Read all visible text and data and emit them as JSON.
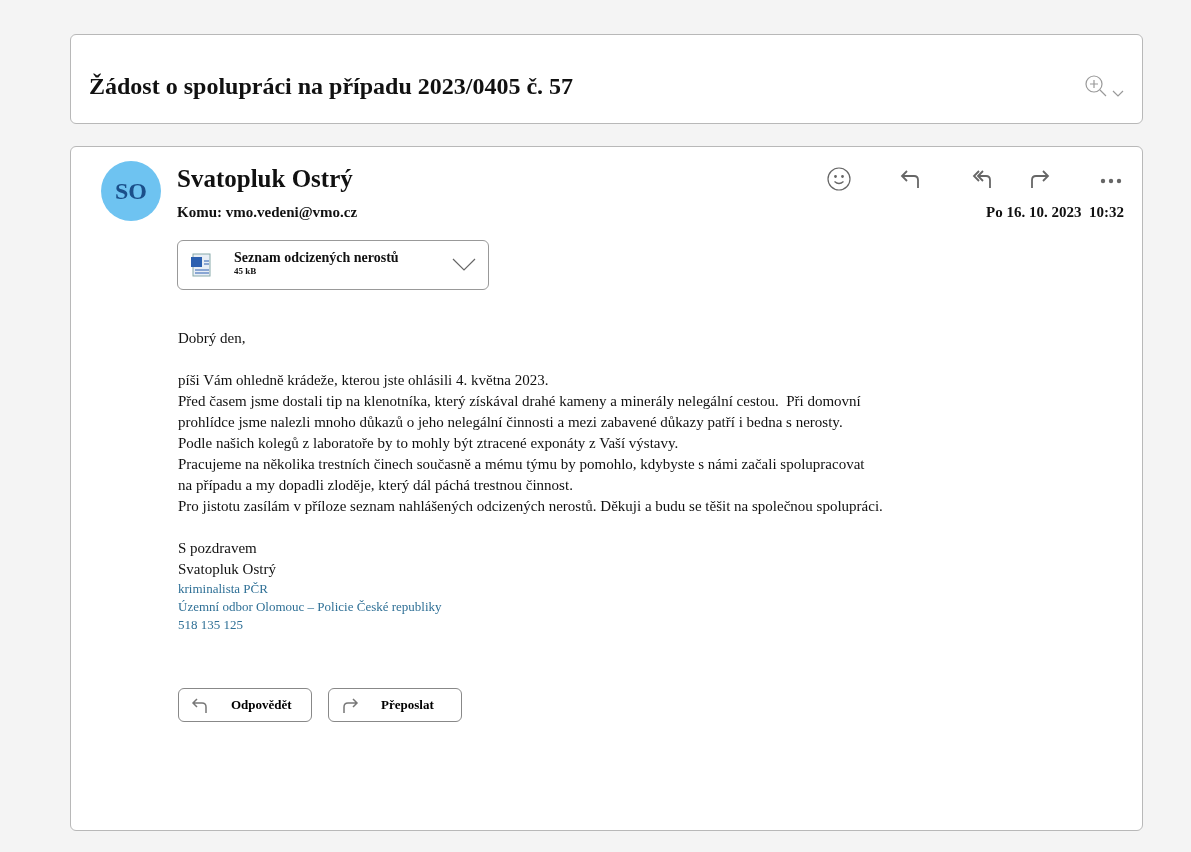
{
  "subject": "Žádost o spolupráci na případu 2023/0405 č. 57",
  "message": {
    "avatar_initials": "SO",
    "sender": "Svatopluk Ostrý",
    "to": "Komu: vmo.vedeni@vmo.cz",
    "date": "Po 16. 10. 2023  10:32",
    "attachment": {
      "name": "Seznam odcizených nerostů",
      "size": "45 kB"
    },
    "greeting": "Dobrý den,",
    "body_lines": [
      "píši Vám ohledně krádeže, kterou jste ohlásili 4. května 2023.",
      "Před časem jsme dostali tip na klenotníka, který získával drahé kameny a minerály nelegální cestou.  Při domovní",
      "prohlídce jsme nalezli mnoho důkazů o jeho nelegální činnosti a mezi zabavené důkazy patří i bedna s nerosty.",
      "Podle našich kolegů z laboratoře by to mohly být ztracené exponáty z Vaší výstavy.",
      "Pracujeme na několika trestních činech současně a mému týmu by pomohlo, kdybyste s námi začali spolupracovat",
      "na případu a my dopadli zloděje, který dál páchá trestnou činnost.",
      "Pro jistotu zasílám v příloze seznam nahlášených odcizených nerostů. Děkuji a budu se těšit na společnou spolupráci."
    ],
    "signature": [
      {
        "text": "S pozdravem",
        "kind": "plain"
      },
      {
        "text": "Svatopluk Ostrý",
        "kind": "plain"
      },
      {
        "text": "kriminalista PČR",
        "kind": "accent"
      },
      {
        "text": "Územní odbor Olomouc – Policie České republiky",
        "kind": "accent"
      },
      {
        "text": "518 135 125",
        "kind": "accent"
      }
    ],
    "actions": [
      {
        "label": "Odpovědět",
        "kind": "reply"
      },
      {
        "label": "Přeposlat",
        "kind": "forward"
      }
    ]
  }
}
